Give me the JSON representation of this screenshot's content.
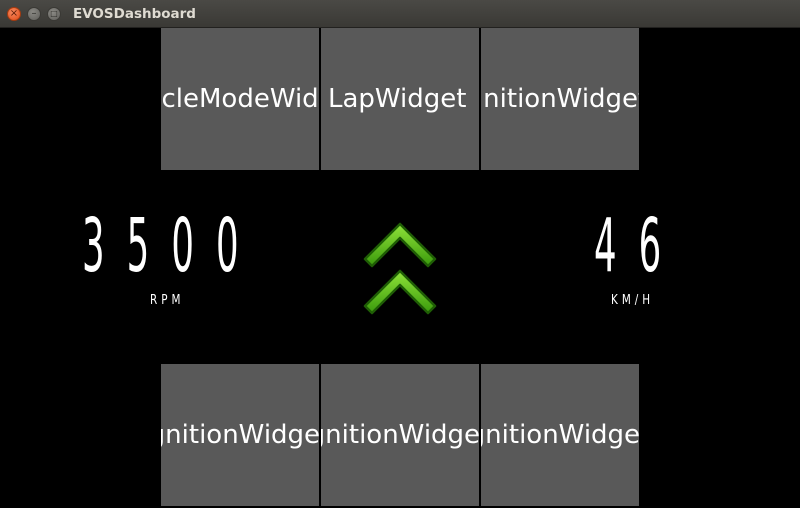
{
  "window": {
    "title": "EVOSDashboard",
    "close_glyph": "×",
    "min_glyph": "–",
    "max_glyph": "□"
  },
  "top_widgets": [
    {
      "label": "VehicleModeWidget"
    },
    {
      "label": "LapWidget"
    },
    {
      "label": "IgnitionWidget"
    }
  ],
  "bottom_widgets": [
    {
      "label": "IgnitionWidget"
    },
    {
      "label": "IgnitionWidget"
    },
    {
      "label": "IgnitionWidget"
    }
  ],
  "rpm": {
    "value": "3500",
    "unit": "RPM"
  },
  "speed": {
    "value": "46",
    "unit": "KM/H"
  },
  "indicator": {
    "icon": "double-chevron-up-icon",
    "color": "#5fc21a"
  }
}
